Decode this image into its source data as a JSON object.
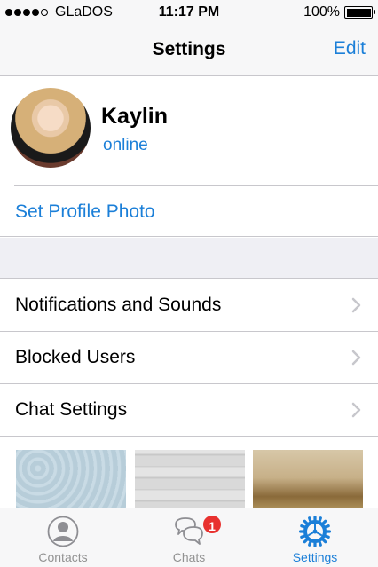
{
  "status_bar": {
    "carrier": "GLaDOS",
    "time": "11:17 PM",
    "battery": "100%",
    "signal_level": 4
  },
  "nav": {
    "title": "Settings",
    "edit_label": "Edit"
  },
  "profile": {
    "name": "Kaylin",
    "status": "online"
  },
  "set_photo_label": "Set Profile Photo",
  "menu": [
    {
      "label": "Notifications and Sounds"
    },
    {
      "label": "Blocked Users"
    },
    {
      "label": "Chat Settings"
    }
  ],
  "tabs": [
    {
      "label": "Contacts",
      "icon": "person-icon",
      "active": false
    },
    {
      "label": "Chats",
      "icon": "chat-bubbles-icon",
      "active": false,
      "badge": "1"
    },
    {
      "label": "Settings",
      "icon": "gear-icon",
      "active": true
    }
  ],
  "colors": {
    "accent": "#1b7fd8",
    "badge": "#e8312f",
    "group_background": "#efeff4"
  }
}
